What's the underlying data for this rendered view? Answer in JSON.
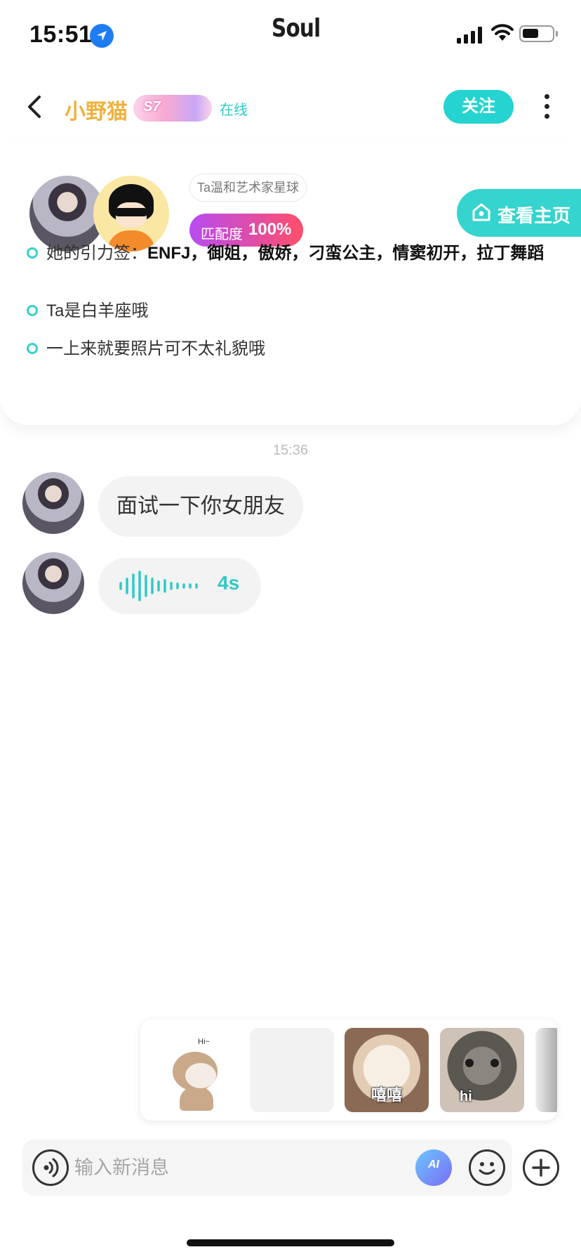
{
  "status_bar": {
    "time": "15:51",
    "app_name": "Soul"
  },
  "header": {
    "nickname": "小野猫",
    "vip_badge": "S7",
    "online_status": "在线",
    "follow_label": "关注"
  },
  "profile_card": {
    "planet_tag": "Ta温和艺术家星球",
    "match_label": "匹配度",
    "match_value": "100%",
    "view_home_label": "查看主页",
    "traits": {
      "tags_prefix": "她的引力签：",
      "tags": "ENFJ，御姐，傲娇，刁蛮公主，情窦初开，拉丁舞蹈",
      "zodiac": "Ta是白羊座哦",
      "tip": "一上来就要照片可不太礼貌哦"
    }
  },
  "chat": {
    "timestamp": "15:36",
    "messages": [
      {
        "type": "text",
        "text": "面试一下你女朋友"
      },
      {
        "type": "voice",
        "duration": "4s"
      }
    ]
  },
  "stickers": {
    "bear_caption": "Hi~",
    "cat1_caption": "嘻嘻",
    "cat2_caption": "hi"
  },
  "input_bar": {
    "placeholder": "输入新消息",
    "ai_label": "AI"
  },
  "colors": {
    "accent": "#25d4d0",
    "nickname": "#f0b13d",
    "match_gradient_start": "#b84cf2",
    "match_gradient_end": "#ff4e6a"
  }
}
